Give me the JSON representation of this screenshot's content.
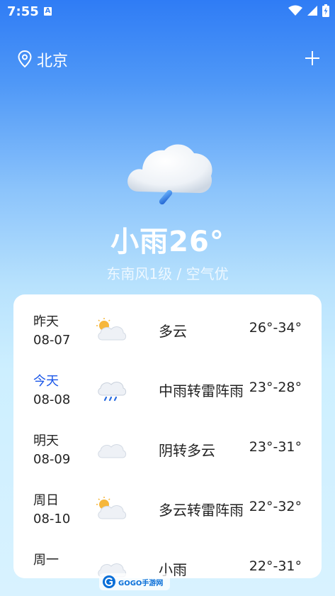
{
  "status": {
    "time": "7:55",
    "a_label": "A"
  },
  "header": {
    "city": "北京"
  },
  "current": {
    "title": "小雨26°",
    "subtitle": "东南风1级 / 空气优"
  },
  "forecast": [
    {
      "day": "昨天",
      "date": "08-07",
      "icon": "partly-cloudy-icon",
      "condition": "多云",
      "temp": "26°-34°"
    },
    {
      "day": "今天",
      "date": "08-08",
      "icon": "rain-cloud-icon",
      "condition": "中雨转雷阵雨",
      "temp": "23°-28°"
    },
    {
      "day": "明天",
      "date": "08-09",
      "icon": "cloud-icon",
      "condition": "阴转多云",
      "temp": "23°-31°"
    },
    {
      "day": "周日",
      "date": "08-10",
      "icon": "partly-cloudy-icon",
      "condition": "多云转雷阵雨",
      "temp": "22°-32°"
    },
    {
      "day": "周一",
      "date": "",
      "icon": "cloud-icon",
      "condition": "小雨",
      "temp": "22°-31°"
    }
  ],
  "watermark": {
    "text": "GOGO手游网"
  },
  "colors": {
    "today": "#1a56e8",
    "sky_top": "#2f7cf5",
    "sky_bottom": "#d8f2ff"
  }
}
